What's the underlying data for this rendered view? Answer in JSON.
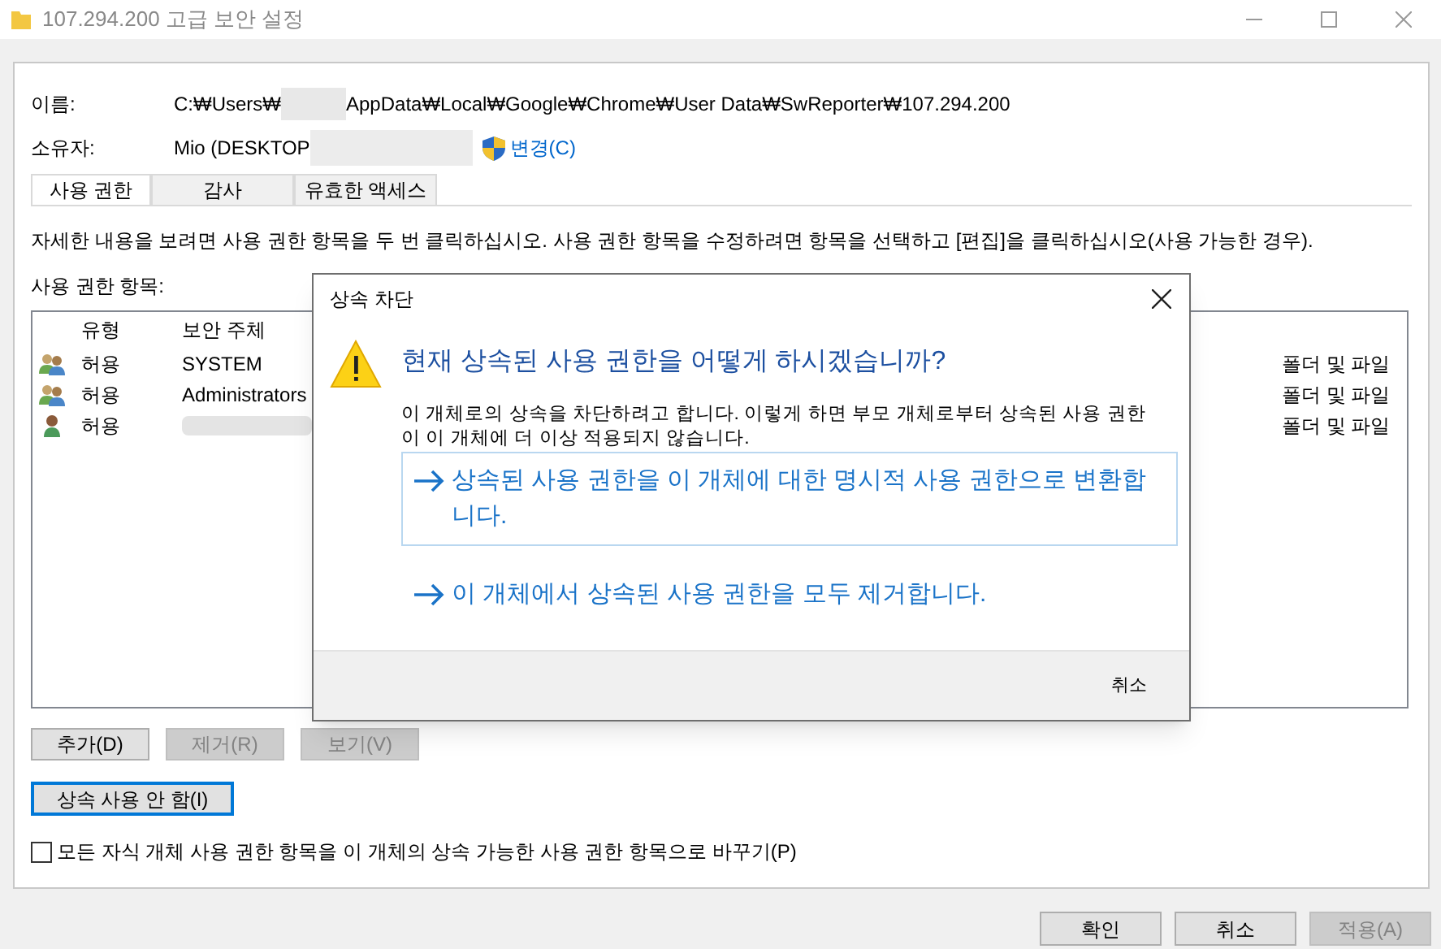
{
  "window": {
    "title": "107.294.200 고급 보안 설정"
  },
  "name": {
    "label": "이름:",
    "value_start": "C:₩Users₩",
    "value_end": "AppData₩Local₩Google₩Chrome₩User Data₩SwReporter₩107.294.200"
  },
  "owner": {
    "label": "소유자:",
    "value": "Mio (DESKTOP",
    "change_link": "변경(C)"
  },
  "tabs": [
    {
      "label": "사용 권한",
      "selected": true
    },
    {
      "label": "감사",
      "selected": false
    },
    {
      "label": "유효한 액세스",
      "selected": false
    }
  ],
  "instructions": "자세한 내용을 보려면 사용 권한 항목을 두 번 클릭하십시오. 사용 권한 항목을 수정하려면 항목을 선택하고 [편집]을 클릭하십시오(사용 가능한 경우).",
  "entries_label": "사용 권한 항목:",
  "table": {
    "columns": [
      "유형",
      "보안 주체"
    ],
    "rows": [
      {
        "kind": "group",
        "type": "허용",
        "principal": "SYSTEM",
        "principal_redacted": false,
        "column_5": "폴더 및 파일"
      },
      {
        "kind": "group",
        "type": "허용",
        "principal": "Administrators",
        "principal_redacted": false,
        "column_5": "폴더 및 파일"
      },
      {
        "kind": "user",
        "type": "허용",
        "principal_redacted": true,
        "column_5": "폴더 및 파일"
      }
    ]
  },
  "entry_buttons": [
    {
      "label": "추가(D)",
      "disabled": false
    },
    {
      "label": "제거(R)",
      "disabled": true
    },
    {
      "label": "보기(V)",
      "disabled": true
    }
  ],
  "disable_inheritance_button": {
    "label": "상속 사용 안 함(I)",
    "focused": true
  },
  "replace_checkbox": {
    "label": "모든 자식 개체 사용 권한 항목을 이 개체의 상속 가능한 사용 권한 항목으로 바꾸기(P)",
    "checked": false
  },
  "footer_buttons": [
    {
      "label": "확인",
      "disabled": false
    },
    {
      "label": "취소",
      "disabled": false
    },
    {
      "label": "적용(A)",
      "disabled": true
    }
  ],
  "dialog": {
    "title": "상속 차단",
    "heading": "현재 상속된 사용 권한을 어떻게 하시겠습니까?",
    "description": "이 개체로의 상속을 차단하려고 합니다. 이렇게 하면 부모 개체로부터 상속된 사용 권한이 이 개체에 더 이상 적용되지 않습니다.",
    "options": [
      {
        "label": "상속된 사용 권한을 이 개체에 대한 명시적 사용 권한으로 변환합니다.",
        "selected": true
      },
      {
        "label": "이 개체에서 상속된 사용 권한을 모두 제거합니다.",
        "selected": false
      }
    ],
    "cancel": "취소"
  }
}
